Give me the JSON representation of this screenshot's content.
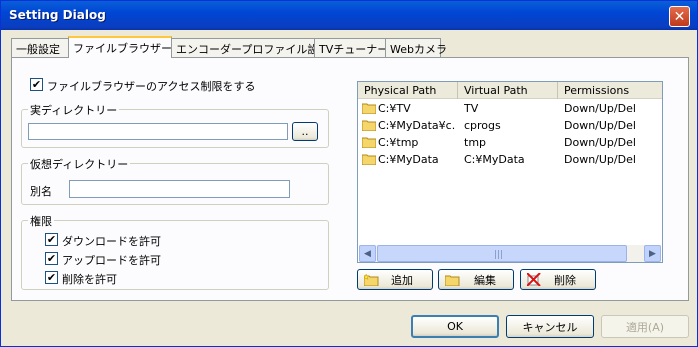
{
  "window": {
    "title": "Setting Dialog",
    "close_glyph": "✕"
  },
  "tabs": [
    {
      "label": "一般設定"
    },
    {
      "label": "ファイルブラウザー"
    },
    {
      "label": "エンコーダープロファイル設定"
    },
    {
      "label": "TVチューナー"
    },
    {
      "label": "Webカメラ"
    }
  ],
  "access_control": {
    "label": "ファイルブラウザーのアクセス制限をする",
    "checked": true
  },
  "real_dir": {
    "title": "実ディレクトリー",
    "value": "",
    "browse_label": ".."
  },
  "virtual_dir": {
    "title": "仮想ディレクトリー",
    "alias_label": "別名",
    "alias_value": ""
  },
  "permissions": {
    "title": "権限",
    "items": [
      {
        "label": "ダウンロードを許可",
        "checked": true
      },
      {
        "label": "アップロードを許可",
        "checked": true
      },
      {
        "label": "削除を許可",
        "checked": true
      }
    ]
  },
  "listview": {
    "columns": [
      "Physical Path",
      "Virtual Path",
      "Permissions"
    ],
    "rows": [
      {
        "physical": "C:¥TV",
        "virtual": "TV",
        "perm": "Down/Up/Del"
      },
      {
        "physical": "C:¥MyData¥c...",
        "virtual": "cprogs",
        "perm": "Down/Up/Del"
      },
      {
        "physical": "C:¥tmp",
        "virtual": "tmp",
        "perm": "Down/Up/Del"
      },
      {
        "physical": "C:¥MyData",
        "virtual": "C:¥MyData",
        "perm": "Down/Up/Del"
      }
    ]
  },
  "list_buttons": {
    "add": "追加",
    "edit": "編集",
    "delete": "削除"
  },
  "footer": {
    "ok": "OK",
    "cancel": "キャンセル",
    "apply": "適用(A)"
  }
}
